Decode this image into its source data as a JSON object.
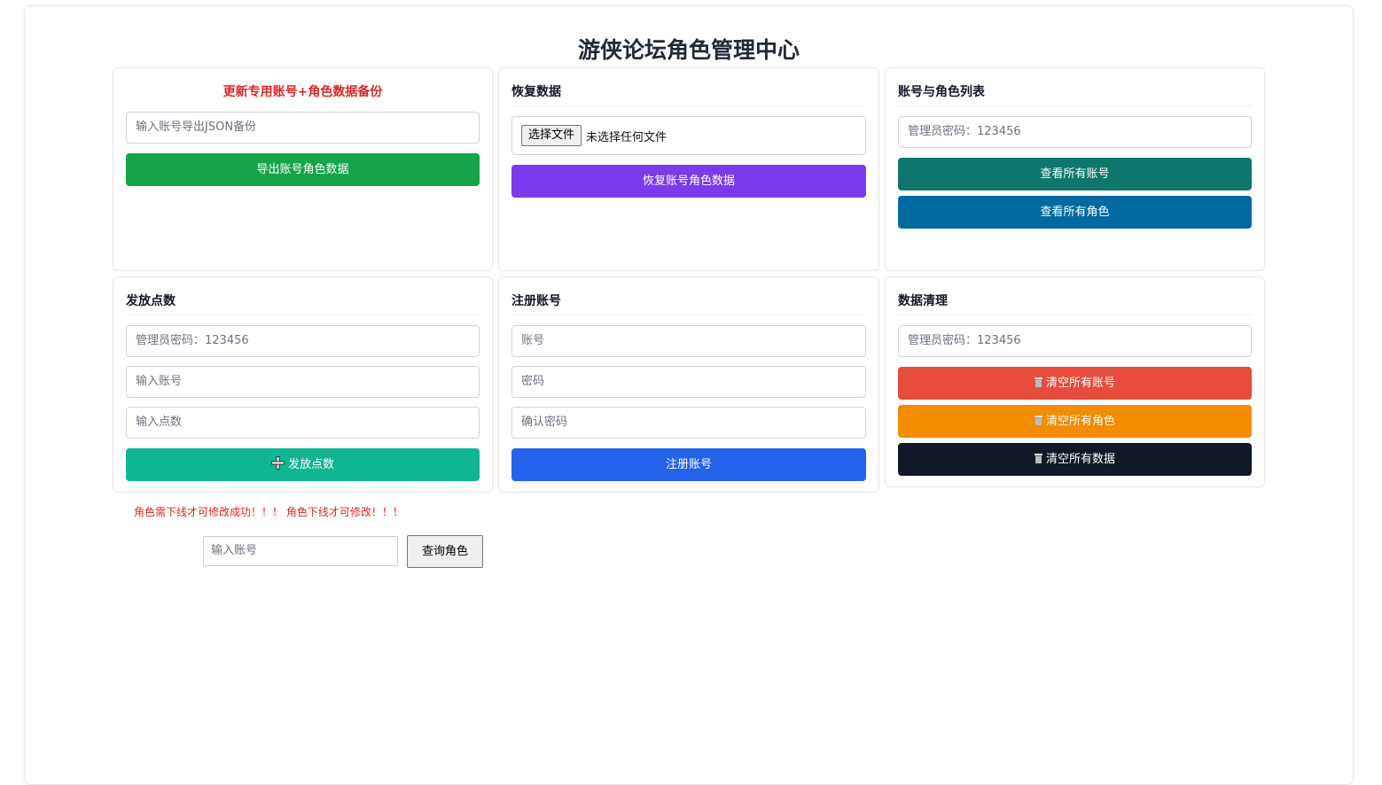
{
  "header": {
    "title": "游侠论坛角色管理中心"
  },
  "backup": {
    "title": "更新专用账号+角色数据备份",
    "account_placeholder": "输入账号导出JSON备份",
    "export_button": "导出账号角色数据"
  },
  "restore": {
    "title": "恢复数据",
    "choose_file_button": "选择文件",
    "no_file_text": "未选择任何文件",
    "restore_button": "恢复账号角色数据"
  },
  "list": {
    "title": "账号与角色列表",
    "admin_password_placeholder": "管理员密码：123456",
    "view_accounts_button": "查看所有账号",
    "view_roles_button": "查看所有角色"
  },
  "points": {
    "title": "发放点数",
    "admin_password_placeholder": "管理员密码：123456",
    "account_placeholder": "输入账号",
    "points_placeholder": "输入点数",
    "issue_button_icon": "plus-icon",
    "issue_button": "发放点数"
  },
  "register": {
    "title": "注册账号",
    "account_placeholder": "账号",
    "password_placeholder": "密码",
    "confirm_placeholder": "确认密码",
    "register_button": "注册账号"
  },
  "cleanup": {
    "title": "数据清理",
    "admin_password_placeholder": "管理员密码：123456",
    "clear_accounts_button": "清空所有账号",
    "clear_roles_button": "清空所有角色",
    "clear_all_button": "清空所有数据",
    "button_icon": "trash-icon"
  },
  "notice": {
    "text": "角色需下线才可修改成功！！！ 角色下线才可修改！！！"
  },
  "query": {
    "account_placeholder": "输入账号",
    "query_button": "查询角色"
  },
  "colors": {
    "green": "#16a34a",
    "purple": "#7c3aed",
    "teal_dark": "#0f766e",
    "blue_dark": "#0369a1",
    "emerald": "#10b594",
    "blue": "#2563eb",
    "red": "#e74c3c",
    "orange": "#f28c00",
    "black": "#111827",
    "warn_red": "#dc2626"
  }
}
